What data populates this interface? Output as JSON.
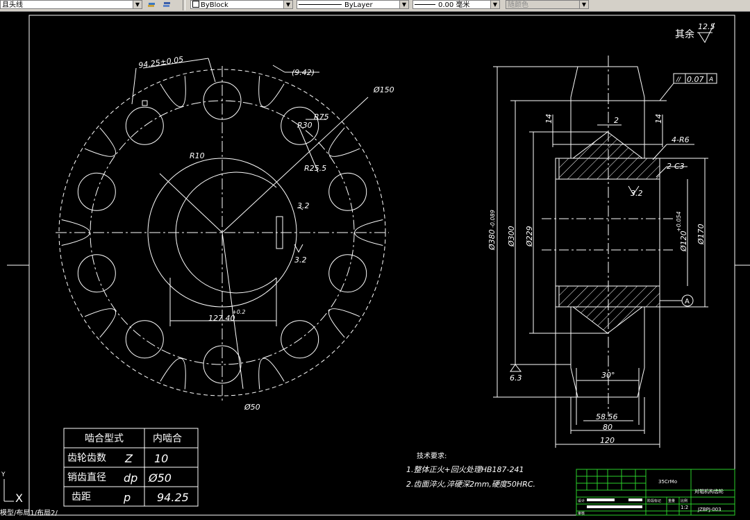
{
  "toolbar": {
    "line_type_label": "且头线",
    "layer_color_value": "ByBlock",
    "linetype_value": "ByLayer",
    "lineweight_value": "0.00 毫米",
    "plotstyle_value": "随颜色"
  },
  "drawing": {
    "roughness_label": "其余",
    "roughness_value": "12.5",
    "left_view": {
      "dim_pitch_tol": "94.25±0.05",
      "dim_942": "(9.42)",
      "dim_phi150": "Ø150",
      "dim_r75": "R75",
      "dim_r30": "R30",
      "dim_r10": "R10",
      "dim_r255": "R25.5",
      "dim_roughness_32a": "3.2",
      "dim_roughness_32b": "3.2",
      "dim_12740": "127.40",
      "dim_12740_tol": "+0.2",
      "dim_phi50": "Ø50"
    },
    "right_view": {
      "tolerance_symbol": "//",
      "tolerance_value": "0.07",
      "tolerance_datum": "A",
      "dim_14_left": "14",
      "dim_14_right": "14",
      "dim_2": "2",
      "dim_4r6": "4-R6",
      "dim_2c3": "2-C3",
      "dim_roughness_32": "3.2",
      "dim_phi380": "Ø380",
      "dim_phi380_tol": "-0.089",
      "dim_phi300": "Ø300",
      "dim_phi229": "Ø229",
      "dim_phi120": "Ø120",
      "dim_phi120_tol": "+0.054",
      "dim_phi170": "Ø170",
      "datum_label": "A",
      "dim_roughness_63": "6.3",
      "dim_30deg": "30°",
      "dim_5856": "58.56",
      "dim_80": "80",
      "dim_120": "120"
    },
    "table": {
      "header_left": "啮合型式",
      "header_right": "内啮合",
      "rows": [
        {
          "label": "齿轮齿数",
          "symbol": "Z",
          "value": "10"
        },
        {
          "label": "销齿直径",
          "symbol": "dp",
          "value": "Ø50"
        },
        {
          "label": "齿距",
          "symbol": "p",
          "value": "94.25"
        }
      ]
    },
    "tech_requirements": {
      "title": "技术要求:",
      "item1": "1.整体正火+回火处理HB187-241",
      "item2": "2.齿面淬火,淬硬深2mm,硬度50HRC."
    },
    "title_block": {
      "material": "35CrMo",
      "part_name": "对辊机构齿轮",
      "drawing_number": "JZBPJ-003",
      "scale": "1:2",
      "label_design": "设计",
      "label_review": "审核",
      "label_stage": "阶段标记",
      "label_weight": "重量",
      "label_ratio": "比例"
    },
    "ucs_label": "X",
    "ucs_label_y": "Y"
  },
  "status_text": "模型/布局1/布局2/"
}
